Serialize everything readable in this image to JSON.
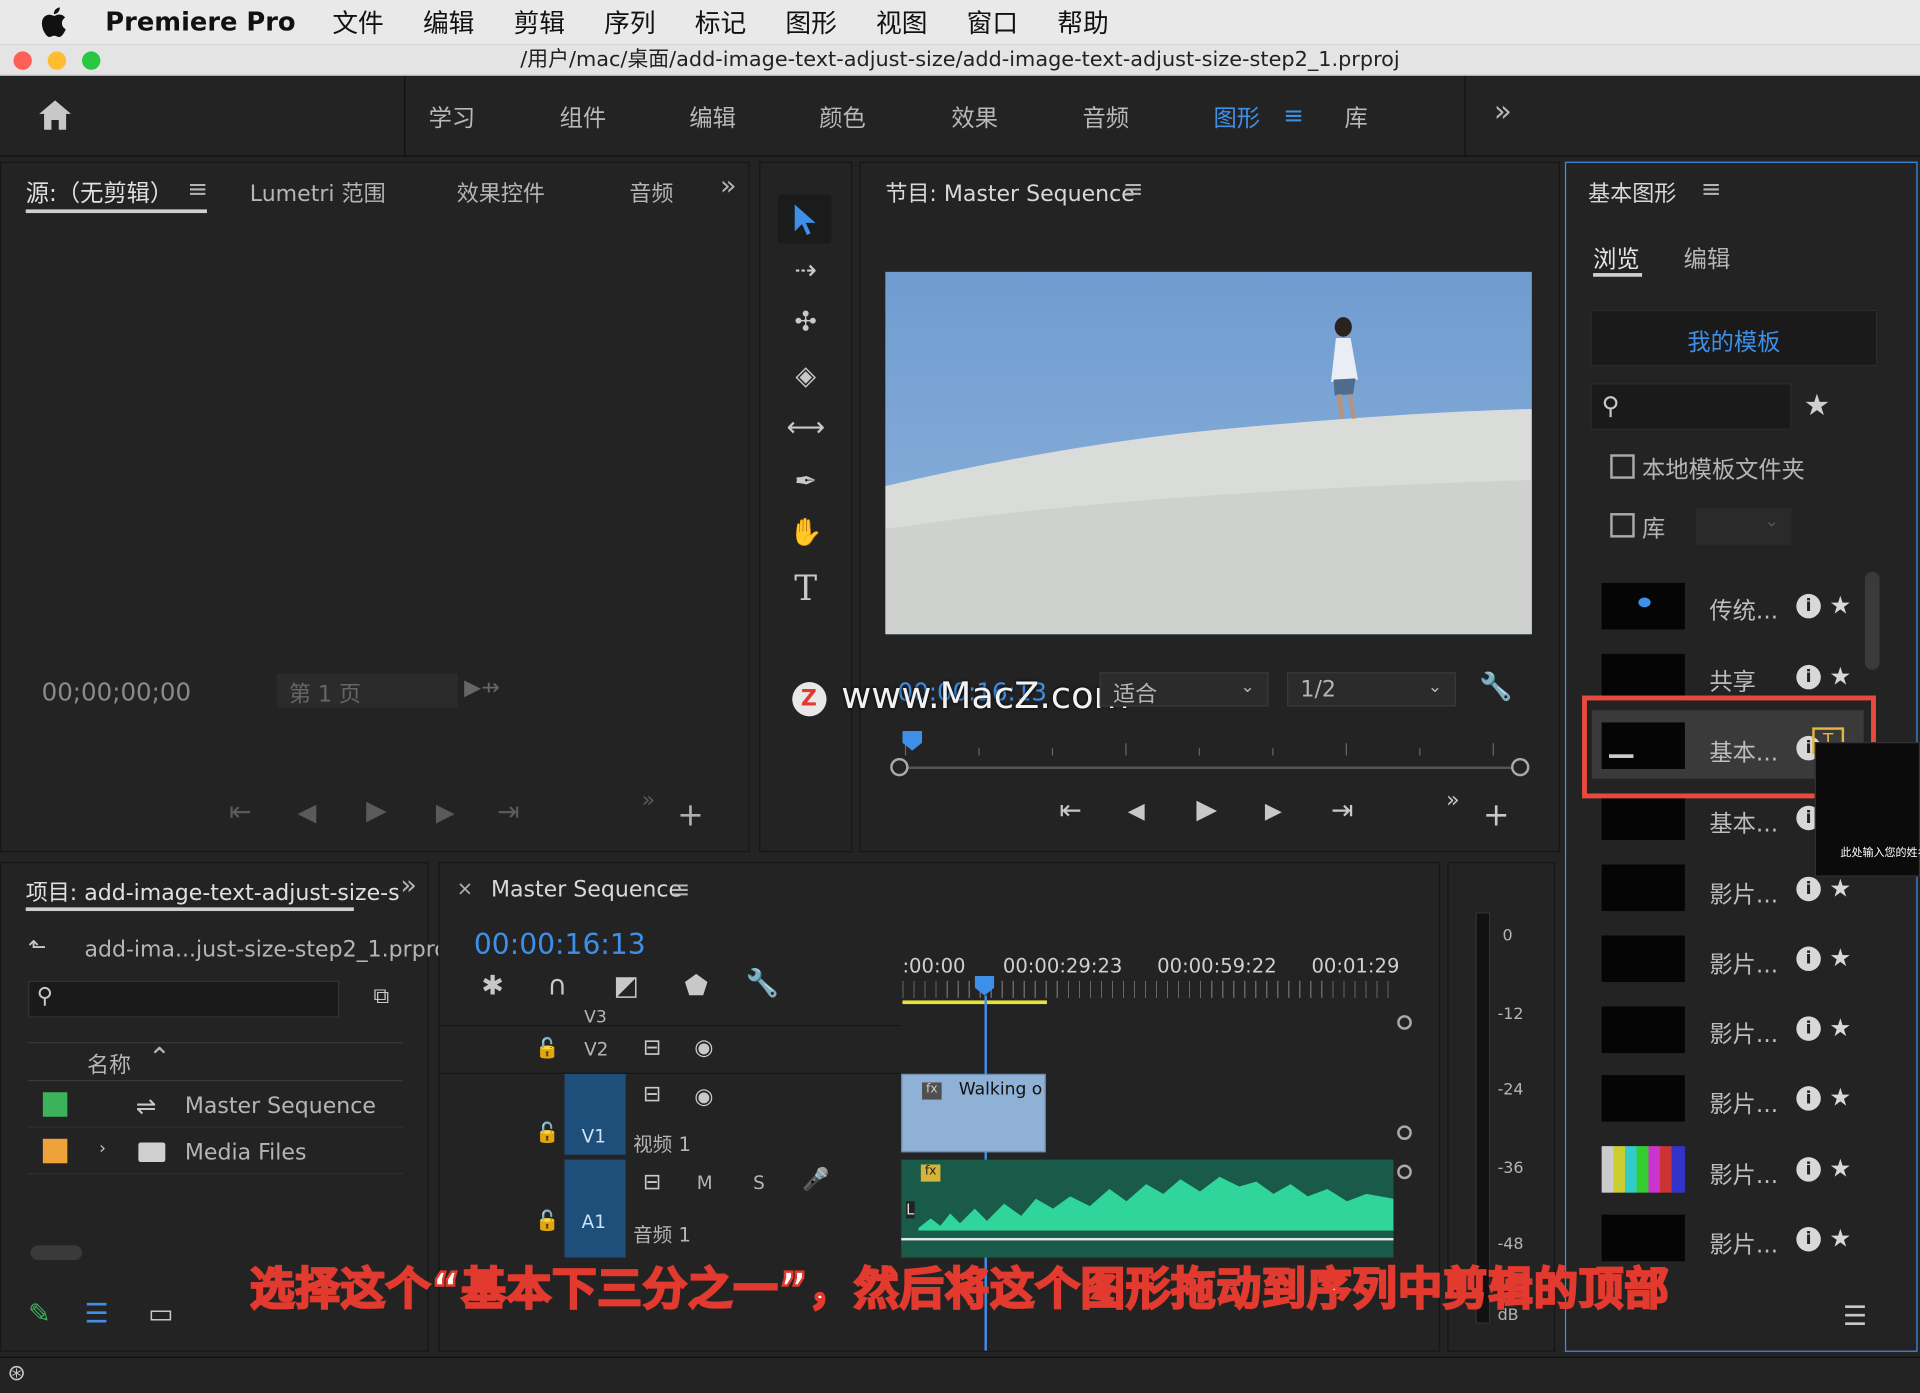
{
  "menubar": {
    "app": "Premiere Pro",
    "items": [
      "文件",
      "编辑",
      "剪辑",
      "序列",
      "标记",
      "图形",
      "视图",
      "窗口",
      "帮助"
    ]
  },
  "titlebar": {
    "path": "/用户/mac/桌面/add-image-text-adjust-size/add-image-text-adjust-size-step2_1.prproj"
  },
  "workspaces": {
    "items": [
      "学习",
      "组件",
      "编辑",
      "颜色",
      "效果",
      "音频",
      "图形",
      "库"
    ],
    "active": "图形",
    "more": "»"
  },
  "source_panel": {
    "tabs": [
      "源:（无剪辑）",
      "Lumetri 范围",
      "效果控件",
      "音频"
    ],
    "timecode": "00;00;00;00",
    "page_select": "第 1 页"
  },
  "program_panel": {
    "title": "节目: Master Sequence",
    "timecode": "00:00:16:13",
    "fit": "适合",
    "resolution": "1/2",
    "watermark": "www.MacZ.com"
  },
  "project_panel": {
    "title": "项目: add-image-text-adjust-size-s",
    "file": "add-ima...just-size-step2_1.prproj",
    "column_name": "名称",
    "items": [
      {
        "name": "Master Sequence",
        "color": "#3cb35a"
      },
      {
        "name": "Media Files",
        "color": "#f0a23a"
      }
    ]
  },
  "timeline": {
    "tab": "Master Sequence",
    "timecode": "00:00:16:13",
    "ruler": [
      ":00:00",
      "00:00:29:23",
      "00:00:59:22",
      "00:01:29"
    ],
    "tracks": {
      "v3": "V3",
      "v2": "V2",
      "v1": "V1",
      "v1_name": "视频 1",
      "a1": "A1",
      "a1_name": "音频 1",
      "m": "M",
      "s": "S"
    },
    "clip_label": "Walking o",
    "fx": "fx",
    "channel": "L"
  },
  "meter": {
    "labels": [
      "0",
      "-12",
      "-24",
      "-36",
      "-48",
      "dB"
    ]
  },
  "essential_graphics": {
    "title": "基本图形",
    "tabs": [
      "浏览",
      "编辑"
    ],
    "my_templates": "我的模板",
    "local_folder": "本地模板文件夹",
    "library": "库",
    "templates": [
      "传统...",
      "共享",
      "基本...",
      "基本...",
      "影片...",
      "影片...",
      "影片...",
      "影片...",
      "影片...",
      "影片..."
    ],
    "preview_text": "此处输入您的姓名"
  },
  "caption": "选择这个“基本下三分之一”，然后将这个图形拖动到序列中剪辑的顶部",
  "colors": {
    "accent": "#3d8fe8",
    "highlight": "#e84a3c",
    "audio": "#2fd59a"
  }
}
